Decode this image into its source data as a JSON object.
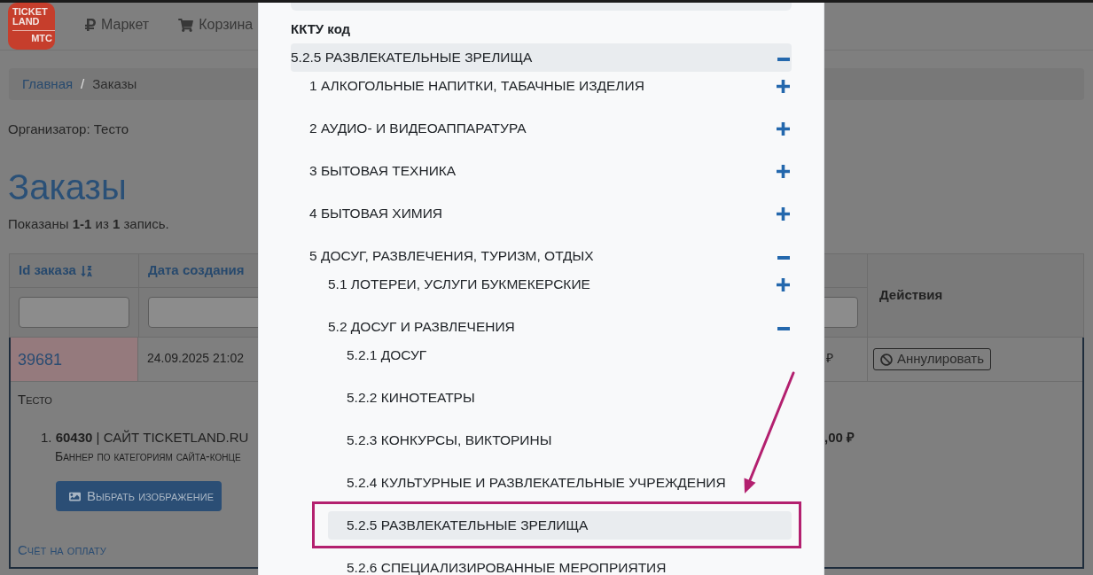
{
  "header": {
    "logo": {
      "lines": [
        "TICKET",
        "LAND"
      ],
      "brand": "МТС"
    },
    "nav": [
      {
        "kind": "ruble",
        "label": "Маркет"
      },
      {
        "kind": "cart",
        "label": "Корзина"
      }
    ]
  },
  "breadcrumb": {
    "items": [
      {
        "kind": "link",
        "label": "Главная"
      },
      {
        "kind": "current",
        "label": "Заказы"
      }
    ],
    "separator": "/"
  },
  "organizer": "Организатор: Тесто",
  "heading": "Заказы",
  "summary": "Показаны **1-1** из **1** запись.",
  "table": {
    "columns": [
      {
        "label": "Id заказа",
        "sorted": true,
        "filter": true
      },
      {
        "label": "Дата создания",
        "sorted": false,
        "filter": true
      },
      {
        "sorted": false,
        "filter": true
      },
      {
        "label": "Действия",
        "sorted": false,
        "filter": false
      }
    ],
    "rows": [
      {
        "id": "39681",
        "highlighted": true,
        "created": "24.09.2025 21:02",
        "amount": "₽",
        "actions": [
          {
            "kind": "cancel",
            "label": "Аннулировать"
          }
        ],
        "expanded": true,
        "details": {
          "customer": "Тесто",
          "items": [
            {
              "text": "1. **60430** | САЙТ TICKETLAND.RU",
              "description": "Баннер по категориям сайта-конце",
              "button": "Выбрать изображение",
              "price": ",00 ₽"
            }
          ],
          "invoice_link": "Счёт на оплату"
        }
      }
    ]
  },
  "modal": {
    "field_label": "ККТУ код",
    "selected": {
      "label": "5.2.5 РАЗВЛЕКАТЕЛЬНЫЕ ЗРЕЛИЩА",
      "expanded": true
    },
    "tree": [
      {
        "kind": "branch",
        "label": "1 АЛКОГОЛЬНЫЕ НАПИТКИ, ТАБАЧНЫЕ ИЗДЕЛИЯ",
        "expanded": false,
        "selected": false,
        "annotated": false
      },
      {
        "kind": "branch",
        "label": "2 АУДИО- И ВИДЕОАППАРАТУРА",
        "expanded": false,
        "selected": false,
        "annotated": false
      },
      {
        "kind": "branch",
        "label": "3 БЫТОВАЯ ТЕХНИКА",
        "expanded": false,
        "selected": false,
        "annotated": false
      },
      {
        "kind": "branch",
        "label": "4 БЫТОВАЯ ХИМИЯ",
        "expanded": false,
        "selected": false,
        "annotated": false
      },
      {
        "kind": "branch",
        "label": "5 ДОСУГ, РАЗВЛЕЧЕНИЯ, ТУРИЗМ, ОТДЫХ",
        "expanded": true,
        "selected": false,
        "annotated": false,
        "children": [
          {
            "kind": "branch",
            "label": "5.1 ЛОТЕРЕИ, УСЛУГИ БУКМЕКЕРСКИЕ",
            "expanded": false,
            "selected": false,
            "annotated": false
          },
          {
            "kind": "branch",
            "label": "5.2 ДОСУГ И РАЗВЛЕЧЕНИЯ",
            "expanded": true,
            "selected": false,
            "annotated": false,
            "children": [
              {
                "kind": "leaf",
                "label": "5.2.1 ДОСУГ",
                "selected": false,
                "annotated": false
              },
              {
                "kind": "leaf",
                "label": "5.2.2 КИНОТЕАТРЫ",
                "selected": false,
                "annotated": false
              },
              {
                "kind": "leaf",
                "label": "5.2.3 КОНКУРСЫ, ВИКТОРИНЫ",
                "selected": false,
                "annotated": false
              },
              {
                "kind": "leaf",
                "label": "5.2.4 КУЛЬТУРНЫЕ И РАЗВЛЕКАТЕЛЬНЫЕ УЧРЕЖДЕНИЯ",
                "selected": false,
                "annotated": false
              },
              {
                "kind": "leaf",
                "label": "5.2.5 РАЗВЛЕКАТЕЛЬНЫЕ ЗРЕЛИЩА",
                "selected": true,
                "annotated": true
              },
              {
                "kind": "leaf",
                "label": "5.2.6 СПЕЦИАЛИЗИРОВАННЫЕ МЕРОПРИЯТИЯ",
                "selected": false,
                "annotated": false
              }
            ]
          }
        ]
      }
    ]
  }
}
